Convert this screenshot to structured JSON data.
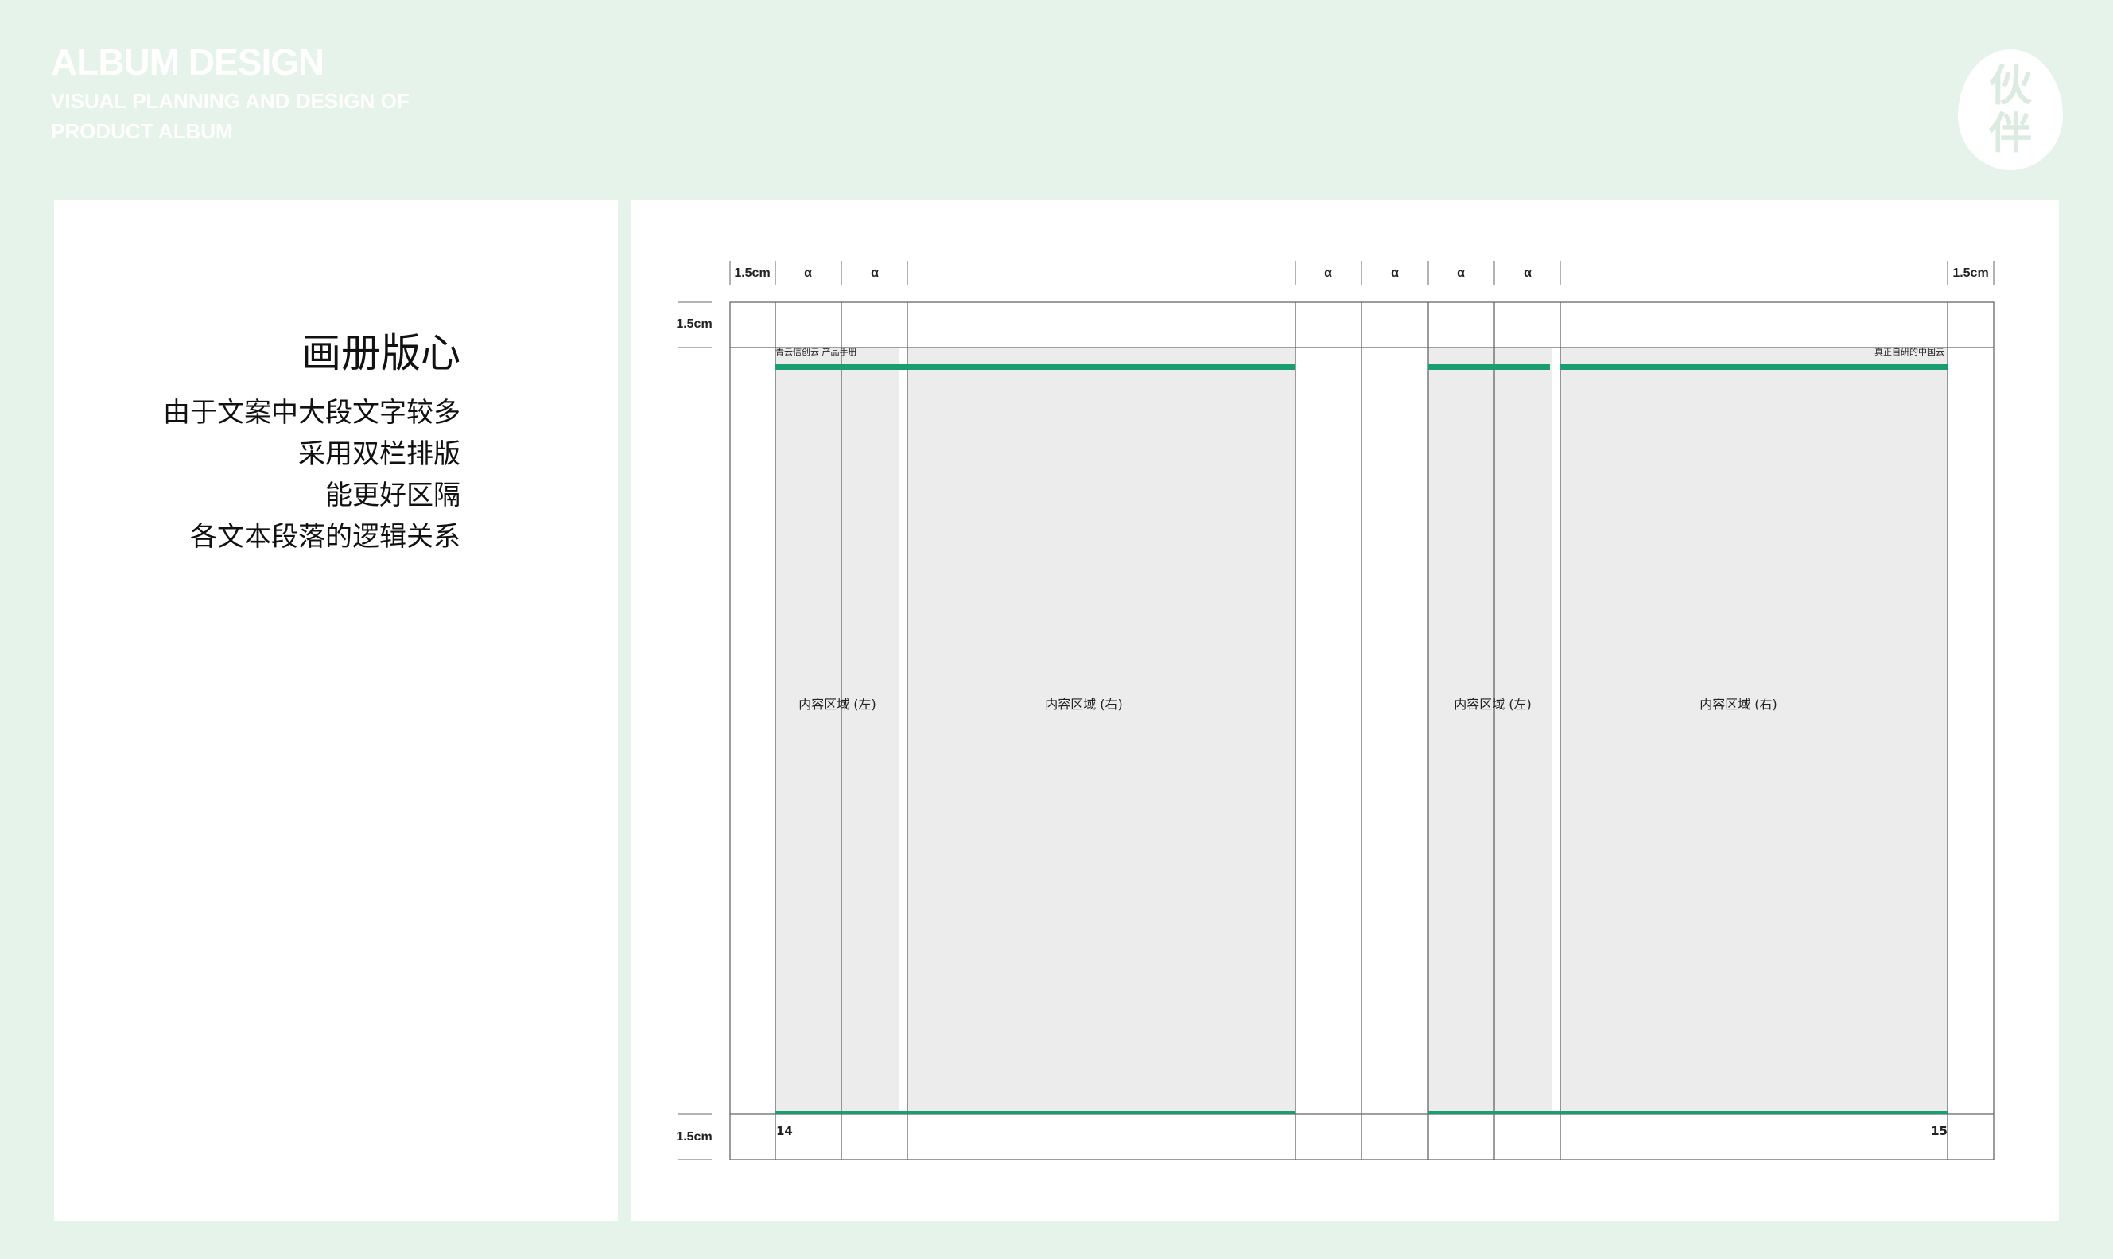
{
  "header": {
    "title": "ALBUM DESIGN",
    "subtitle": "VISUAL PLANNING AND DESIGN OF PRODUCT ALBUM"
  },
  "logo": {
    "char1": "伙",
    "char2": "伴"
  },
  "left_panel": {
    "title": "画册版心",
    "lines": [
      "由于文案中大段文字较多",
      "采用双栏排版",
      "能更好区隔",
      "各文本段落的逻辑关系"
    ]
  },
  "diagram": {
    "margin_label": "1.5cm",
    "column_label": "α",
    "left_page": {
      "header_text": "青云信创云 产品手册",
      "page_number": "14",
      "col_left_label": "内容区域 (左)",
      "col_right_label": "内容区域 (右)"
    },
    "right_page": {
      "header_text": "真正自研的中国云",
      "page_number": "15",
      "col_left_label": "内容区域 (左)",
      "col_right_label": "内容区域 (右)"
    }
  },
  "colors": {
    "background": "#e6f3ea",
    "accent_line": "#1a9e6e",
    "content_fill": "#ececec",
    "grid_line": "#555555"
  }
}
